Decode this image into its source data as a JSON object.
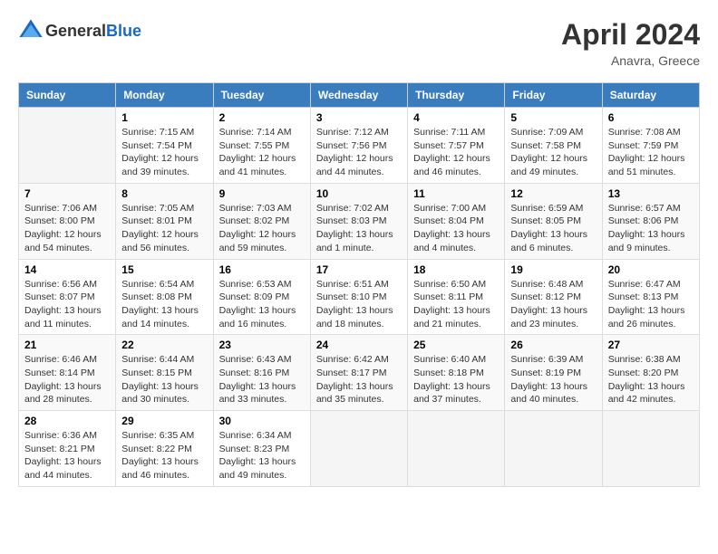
{
  "header": {
    "logo_general": "General",
    "logo_blue": "Blue",
    "month": "April 2024",
    "location": "Anavra, Greece"
  },
  "weekdays": [
    "Sunday",
    "Monday",
    "Tuesday",
    "Wednesday",
    "Thursday",
    "Friday",
    "Saturday"
  ],
  "weeks": [
    [
      {
        "day": "",
        "info": ""
      },
      {
        "day": "1",
        "info": "Sunrise: 7:15 AM\nSunset: 7:54 PM\nDaylight: 12 hours and 39 minutes."
      },
      {
        "day": "2",
        "info": "Sunrise: 7:14 AM\nSunset: 7:55 PM\nDaylight: 12 hours and 41 minutes."
      },
      {
        "day": "3",
        "info": "Sunrise: 7:12 AM\nSunset: 7:56 PM\nDaylight: 12 hours and 44 minutes."
      },
      {
        "day": "4",
        "info": "Sunrise: 7:11 AM\nSunset: 7:57 PM\nDaylight: 12 hours and 46 minutes."
      },
      {
        "day": "5",
        "info": "Sunrise: 7:09 AM\nSunset: 7:58 PM\nDaylight: 12 hours and 49 minutes."
      },
      {
        "day": "6",
        "info": "Sunrise: 7:08 AM\nSunset: 7:59 PM\nDaylight: 12 hours and 51 minutes."
      }
    ],
    [
      {
        "day": "7",
        "info": "Sunrise: 7:06 AM\nSunset: 8:00 PM\nDaylight: 12 hours and 54 minutes."
      },
      {
        "day": "8",
        "info": "Sunrise: 7:05 AM\nSunset: 8:01 PM\nDaylight: 12 hours and 56 minutes."
      },
      {
        "day": "9",
        "info": "Sunrise: 7:03 AM\nSunset: 8:02 PM\nDaylight: 12 hours and 59 minutes."
      },
      {
        "day": "10",
        "info": "Sunrise: 7:02 AM\nSunset: 8:03 PM\nDaylight: 13 hours and 1 minute."
      },
      {
        "day": "11",
        "info": "Sunrise: 7:00 AM\nSunset: 8:04 PM\nDaylight: 13 hours and 4 minutes."
      },
      {
        "day": "12",
        "info": "Sunrise: 6:59 AM\nSunset: 8:05 PM\nDaylight: 13 hours and 6 minutes."
      },
      {
        "day": "13",
        "info": "Sunrise: 6:57 AM\nSunset: 8:06 PM\nDaylight: 13 hours and 9 minutes."
      }
    ],
    [
      {
        "day": "14",
        "info": "Sunrise: 6:56 AM\nSunset: 8:07 PM\nDaylight: 13 hours and 11 minutes."
      },
      {
        "day": "15",
        "info": "Sunrise: 6:54 AM\nSunset: 8:08 PM\nDaylight: 13 hours and 14 minutes."
      },
      {
        "day": "16",
        "info": "Sunrise: 6:53 AM\nSunset: 8:09 PM\nDaylight: 13 hours and 16 minutes."
      },
      {
        "day": "17",
        "info": "Sunrise: 6:51 AM\nSunset: 8:10 PM\nDaylight: 13 hours and 18 minutes."
      },
      {
        "day": "18",
        "info": "Sunrise: 6:50 AM\nSunset: 8:11 PM\nDaylight: 13 hours and 21 minutes."
      },
      {
        "day": "19",
        "info": "Sunrise: 6:48 AM\nSunset: 8:12 PM\nDaylight: 13 hours and 23 minutes."
      },
      {
        "day": "20",
        "info": "Sunrise: 6:47 AM\nSunset: 8:13 PM\nDaylight: 13 hours and 26 minutes."
      }
    ],
    [
      {
        "day": "21",
        "info": "Sunrise: 6:46 AM\nSunset: 8:14 PM\nDaylight: 13 hours and 28 minutes."
      },
      {
        "day": "22",
        "info": "Sunrise: 6:44 AM\nSunset: 8:15 PM\nDaylight: 13 hours and 30 minutes."
      },
      {
        "day": "23",
        "info": "Sunrise: 6:43 AM\nSunset: 8:16 PM\nDaylight: 13 hours and 33 minutes."
      },
      {
        "day": "24",
        "info": "Sunrise: 6:42 AM\nSunset: 8:17 PM\nDaylight: 13 hours and 35 minutes."
      },
      {
        "day": "25",
        "info": "Sunrise: 6:40 AM\nSunset: 8:18 PM\nDaylight: 13 hours and 37 minutes."
      },
      {
        "day": "26",
        "info": "Sunrise: 6:39 AM\nSunset: 8:19 PM\nDaylight: 13 hours and 40 minutes."
      },
      {
        "day": "27",
        "info": "Sunrise: 6:38 AM\nSunset: 8:20 PM\nDaylight: 13 hours and 42 minutes."
      }
    ],
    [
      {
        "day": "28",
        "info": "Sunrise: 6:36 AM\nSunset: 8:21 PM\nDaylight: 13 hours and 44 minutes."
      },
      {
        "day": "29",
        "info": "Sunrise: 6:35 AM\nSunset: 8:22 PM\nDaylight: 13 hours and 46 minutes."
      },
      {
        "day": "30",
        "info": "Sunrise: 6:34 AM\nSunset: 8:23 PM\nDaylight: 13 hours and 49 minutes."
      },
      {
        "day": "",
        "info": ""
      },
      {
        "day": "",
        "info": ""
      },
      {
        "day": "",
        "info": ""
      },
      {
        "day": "",
        "info": ""
      }
    ]
  ]
}
